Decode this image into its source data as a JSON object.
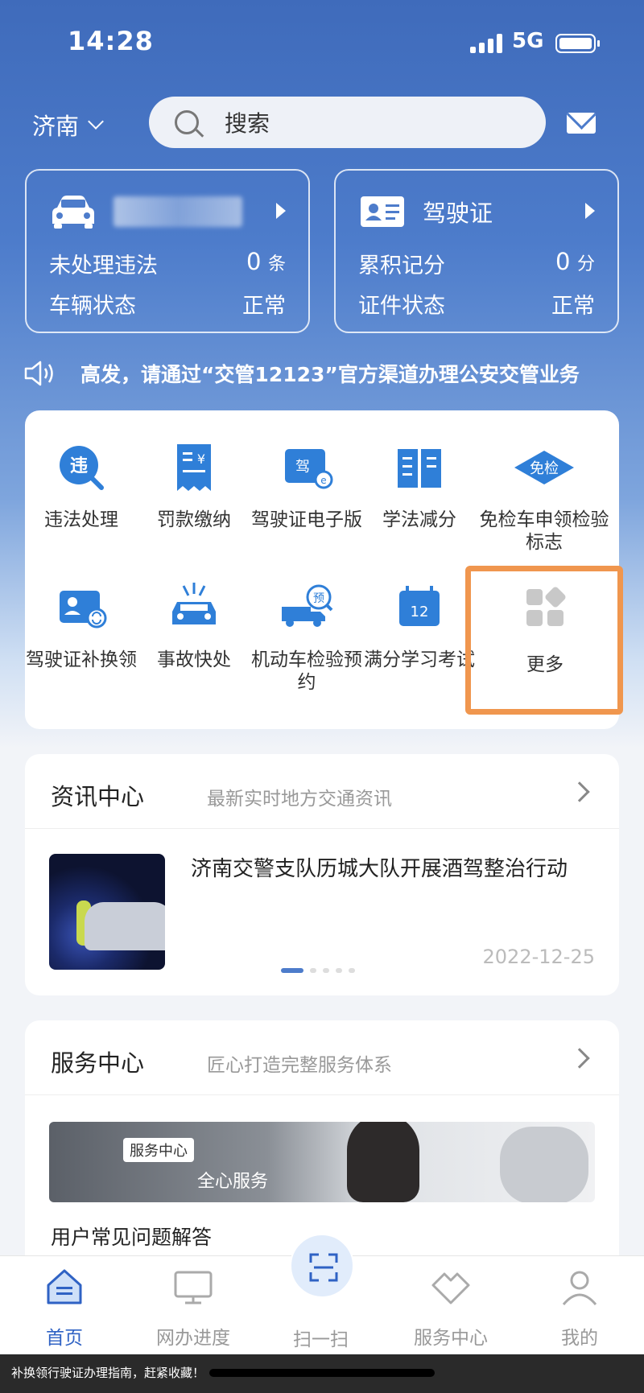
{
  "status": {
    "time": "14:28",
    "network": "5G"
  },
  "header": {
    "city": "济南",
    "search_placeholder": "搜索"
  },
  "vehicle_card": {
    "rows": [
      {
        "label": "未处理违法",
        "value": "0",
        "unit": "条"
      },
      {
        "label": "车辆状态",
        "value": "正常"
      }
    ]
  },
  "license_card": {
    "title": "驾驶证",
    "rows": [
      {
        "label": "累积记分",
        "value": "0",
        "unit": "分"
      },
      {
        "label": "证件状态",
        "value": "正常"
      }
    ]
  },
  "notice": {
    "text": "高发，请通过“交管12123”官方渠道办理公安交管业务"
  },
  "services": [
    {
      "label": "违法处理",
      "icon": "violation-icon"
    },
    {
      "label": "罚款缴纳",
      "icon": "fine-payment-icon"
    },
    {
      "label": "驾驶证电子版",
      "icon": "e-license-icon"
    },
    {
      "label": "学法减分",
      "icon": "study-book-icon"
    },
    {
      "label": "免检车申领检验标志",
      "icon": "inspection-exempt-icon",
      "badge": "免检"
    },
    {
      "label": "驾驶证补换领",
      "icon": "license-renew-icon"
    },
    {
      "label": "事故快处",
      "icon": "accident-icon"
    },
    {
      "label": "机动车检验预约",
      "icon": "inspection-booking-icon",
      "badge": "预"
    },
    {
      "label": "满分学习考试",
      "icon": "full-score-exam-icon",
      "badge": "12"
    },
    {
      "label": "更多",
      "icon": "more-grid-icon"
    }
  ],
  "news_section": {
    "title": "资讯中心",
    "subtitle": "最新实时地方交通资讯",
    "item": {
      "title": "济南交警支队历城大队开展酒驾整治行动",
      "date": "2022-12-25"
    }
  },
  "service_section": {
    "title": "服务中心",
    "subtitle": "匠心打造完整服务体系",
    "banner_tag": "服务中心",
    "banner_text": "全心服务",
    "faq": "用户常见问题解答"
  },
  "tabs": [
    {
      "label": "首页",
      "icon": "home-icon",
      "active": true
    },
    {
      "label": "网办进度",
      "icon": "monitor-icon"
    },
    {
      "label": "扫一扫",
      "icon": "scan-icon"
    },
    {
      "label": "服务中心",
      "icon": "handshake-icon"
    },
    {
      "label": "我的",
      "icon": "user-icon"
    }
  ],
  "caption": "补换领行驶证办理指南，赶紧收藏！",
  "colors": {
    "primary": "#2f62c4",
    "highlight": "#f0964e"
  }
}
